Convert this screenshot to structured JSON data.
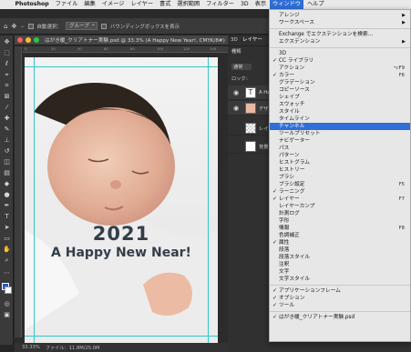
{
  "menubar": {
    "apple": "",
    "items": [
      "Photoshop",
      "ファイル",
      "編集",
      "イメージ",
      "レイヤー",
      "書式",
      "選択範囲",
      "フィルター",
      "3D",
      "表示",
      "ウィンドウ",
      "ヘルプ"
    ],
    "active_index": 10
  },
  "optbar": {
    "autoselect_label": "自動選択：",
    "group_value": "グループ",
    "bbox_label": "バウンディングボックスを表示"
  },
  "document": {
    "tab_title": "はがき暖_クリアトナー実験.psd @ 33.3% (A Happy New Year!, CMYK/8#)",
    "card_year": "2021",
    "card_message": "A Happy New Near!",
    "zoom": "33.33%",
    "file_info": "ファイル：11.8M/25.0M",
    "ruler_ticks": [
      "0",
      "20",
      "40",
      "60",
      "80",
      "100",
      "120",
      "140"
    ]
  },
  "panels": {
    "tabs": [
      "3D",
      "レイヤー"
    ],
    "search_label": "種類",
    "blend_mode": "通常",
    "lock_label": "ロック：",
    "layers": [
      {
        "name": "A Ha"
      },
      {
        "name": "デザイ"
      },
      {
        "name": "レイヤ"
      },
      {
        "name": "背景"
      }
    ]
  },
  "window_menu": {
    "items": [
      {
        "label": "アレンジ",
        "arrow": "▶"
      },
      {
        "label": "ワークスペース",
        "arrow": "▶"
      },
      {
        "sep": true
      },
      {
        "label": "Exchange でエクステンションを検索..."
      },
      {
        "label": "エクステンション",
        "arrow": "▶"
      },
      {
        "sep": true
      },
      {
        "label": "3D"
      },
      {
        "label": "CC ライブラリ",
        "check": true
      },
      {
        "label": "アクション",
        "shortcut": "⌥F9"
      },
      {
        "label": "カラー",
        "check": true,
        "shortcut": "F6"
      },
      {
        "label": "グラデーション"
      },
      {
        "label": "コピーソース"
      },
      {
        "label": "シェイプ"
      },
      {
        "label": "スウォッチ"
      },
      {
        "label": "スタイル"
      },
      {
        "label": "タイムライン"
      },
      {
        "label": "チャンネル",
        "highlight": true
      },
      {
        "label": "ツールプリセット"
      },
      {
        "label": "ナビゲーター"
      },
      {
        "label": "パス"
      },
      {
        "label": "パターン"
      },
      {
        "label": "ヒストグラム"
      },
      {
        "label": "ヒストリー"
      },
      {
        "label": "ブラシ"
      },
      {
        "label": "ブラシ設定",
        "shortcut": "F5"
      },
      {
        "label": "ラーニング",
        "check": true
      },
      {
        "label": "レイヤー",
        "check": true,
        "shortcut": "F7"
      },
      {
        "label": "レイヤーカンプ"
      },
      {
        "label": "計測ログ"
      },
      {
        "label": "字形"
      },
      {
        "label": "情報",
        "shortcut": "F8"
      },
      {
        "label": "色調補正"
      },
      {
        "label": "属性",
        "check": true
      },
      {
        "label": "段落"
      },
      {
        "label": "段落スタイル"
      },
      {
        "label": "注釈"
      },
      {
        "label": "文字"
      },
      {
        "label": "文字スタイル"
      },
      {
        "sep": true
      },
      {
        "label": "アプリケーションフレーム",
        "check": true
      },
      {
        "label": "オプション",
        "check": true
      },
      {
        "label": "ツール",
        "check": true
      },
      {
        "sep": true
      },
      {
        "label": "はがき暖_クリアトナー実験.psd",
        "check": true
      }
    ]
  },
  "colors": {
    "accent": "#2f6fd6",
    "guide": "#34c7c7",
    "card_text": "#333e4a"
  }
}
